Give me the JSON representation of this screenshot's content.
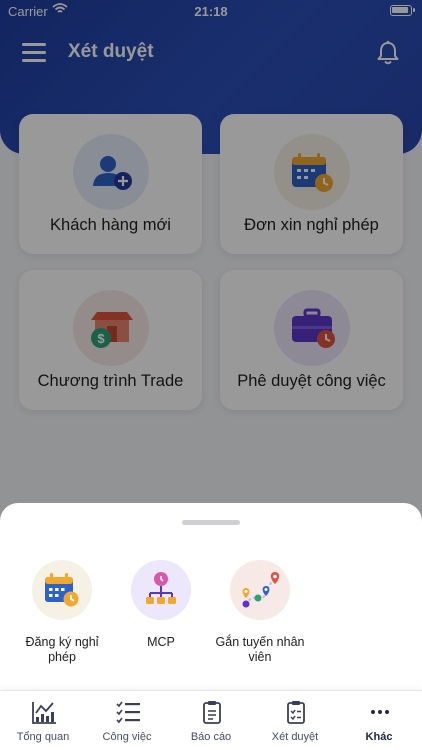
{
  "status_bar": {
    "carrier": "Carrier",
    "time": "21:18"
  },
  "header": {
    "title": "Xét duyệt"
  },
  "cards": [
    {
      "label": "Khách hàng mới",
      "icon": "add-user-icon"
    },
    {
      "label": "Đơn xin nghỉ phép",
      "icon": "calendar-clock-icon"
    },
    {
      "label": "Chương trình Trade",
      "icon": "store-dollar-icon"
    },
    {
      "label": "Phê duyệt công việc",
      "icon": "briefcase-clock-icon"
    }
  ],
  "sheet": {
    "items": [
      {
        "label": "Đăng ký nghỉ phép",
        "icon": "calendar-clock-icon"
      },
      {
        "label": "MCP",
        "icon": "route-tree-icon"
      },
      {
        "label": "Gắn tuyến nhân viên",
        "icon": "route-pins-icon"
      }
    ]
  },
  "tabbar": {
    "active": "Khác",
    "items": [
      {
        "label": "Tổng quan",
        "icon": "chart-icon"
      },
      {
        "label": "Công việc",
        "icon": "checklist-icon"
      },
      {
        "label": "Báo cáo",
        "icon": "clipboard-icon"
      },
      {
        "label": "Xét duyệt",
        "icon": "clipboard-check-icon"
      },
      {
        "label": "Khác",
        "icon": "more-icon"
      }
    ]
  },
  "colors": {
    "header": "#2440a8",
    "overlay": "rgba(0,0,0,0.40)",
    "icon_blue": "#2d63c8",
    "icon_yellow": "#f2a72f",
    "icon_red": "#e0533f",
    "icon_purple": "#5a36c8",
    "icon_green": "#2aa37a"
  }
}
